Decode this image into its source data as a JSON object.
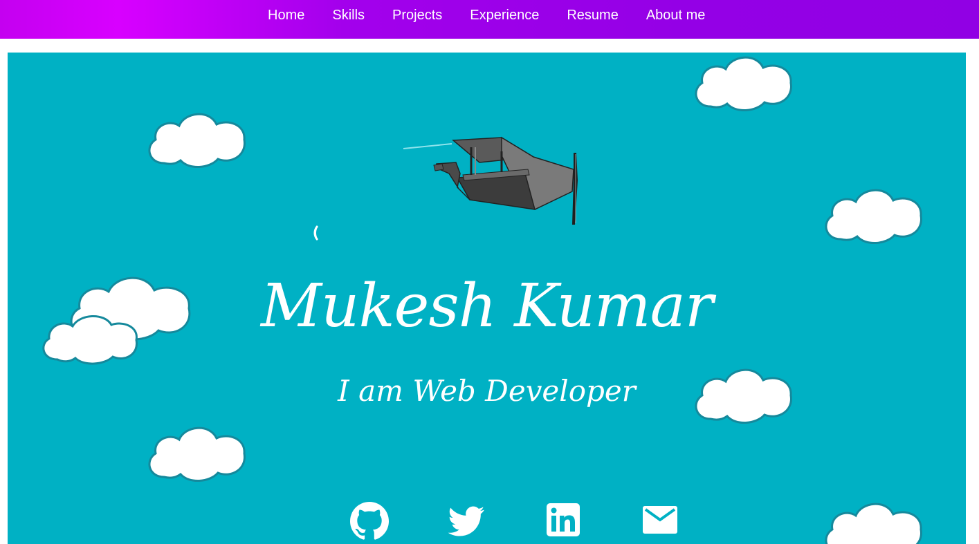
{
  "nav": {
    "items": [
      {
        "label": "Home"
      },
      {
        "label": "Skills"
      },
      {
        "label": "Projects"
      },
      {
        "label": "Experience"
      },
      {
        "label": "Resume"
      },
      {
        "label": "About me"
      }
    ]
  },
  "hero": {
    "name": "Mukesh Kumar",
    "tagline": "I am Web Developer",
    "background_color": "#00b1c4",
    "decoration": [
      "cloud-icon",
      "airplane-icon"
    ]
  },
  "social": [
    {
      "icon": "github-icon"
    },
    {
      "icon": "twitter-icon"
    },
    {
      "icon": "linkedin-icon"
    },
    {
      "icon": "email-icon"
    }
  ],
  "colors": {
    "nav_gradient_start": "#d800ff",
    "nav_gradient_end": "#9100e4",
    "cloud_fill": "#ffffff",
    "cloud_stroke": "#15899c"
  }
}
